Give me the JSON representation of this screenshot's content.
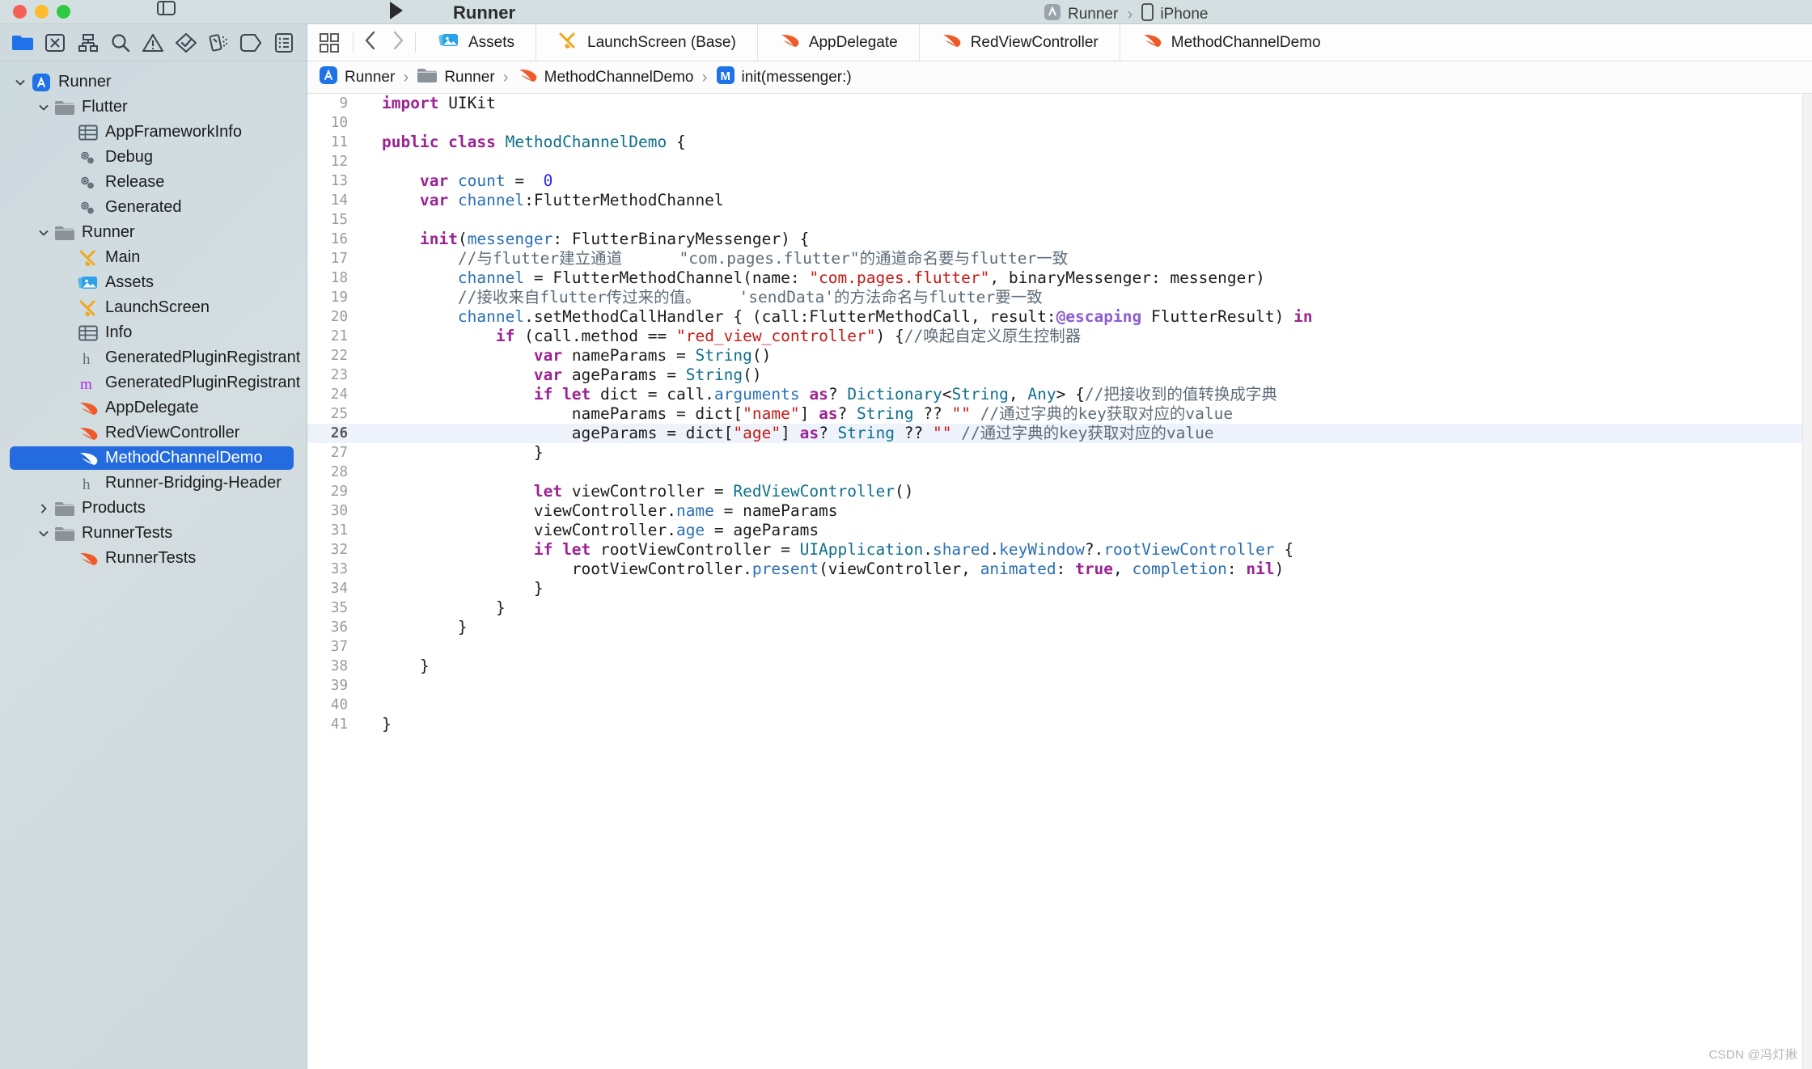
{
  "window": {
    "title": "Runner",
    "right_breadcrumb_project": "Runner",
    "right_breadcrumb_device": "iPhone"
  },
  "navigator_toolbar": {
    "items": [
      {
        "name": "project-navigator-icon",
        "label": "Project"
      },
      {
        "name": "source-control-navigator-icon",
        "label": "Source Control"
      },
      {
        "name": "symbol-navigator-icon",
        "label": "Symbols"
      },
      {
        "name": "find-navigator-icon",
        "label": "Find"
      },
      {
        "name": "issue-navigator-icon",
        "label": "Issues"
      },
      {
        "name": "test-navigator-icon",
        "label": "Tests"
      },
      {
        "name": "debug-navigator-icon",
        "label": "Debug"
      },
      {
        "name": "breakpoint-navigator-icon",
        "label": "Breakpoints"
      },
      {
        "name": "report-navigator-icon",
        "label": "Reports"
      }
    ]
  },
  "navigator": {
    "rows": [
      {
        "label": "Runner",
        "icon": "app-icon",
        "indent": 0,
        "disclosure": "open",
        "selected": false
      },
      {
        "label": "Flutter",
        "icon": "folder-icon",
        "indent": 1,
        "disclosure": "open",
        "selected": false
      },
      {
        "label": "AppFrameworkInfo",
        "icon": "plist-icon",
        "indent": 2,
        "disclosure": "none",
        "selected": false
      },
      {
        "label": "Debug",
        "icon": "config-icon",
        "indent": 2,
        "disclosure": "none",
        "selected": false
      },
      {
        "label": "Release",
        "icon": "config-icon",
        "indent": 2,
        "disclosure": "none",
        "selected": false
      },
      {
        "label": "Generated",
        "icon": "config-icon",
        "indent": 2,
        "disclosure": "none",
        "selected": false
      },
      {
        "label": "Runner",
        "icon": "folder-icon",
        "indent": 1,
        "disclosure": "open",
        "selected": false
      },
      {
        "label": "Main",
        "icon": "storyboard-icon",
        "indent": 2,
        "disclosure": "none",
        "selected": false
      },
      {
        "label": "Assets",
        "icon": "assets-icon",
        "indent": 2,
        "disclosure": "none",
        "selected": false
      },
      {
        "label": "LaunchScreen",
        "icon": "storyboard-icon",
        "indent": 2,
        "disclosure": "none",
        "selected": false
      },
      {
        "label": "Info",
        "icon": "plist-icon",
        "indent": 2,
        "disclosure": "none",
        "selected": false
      },
      {
        "label": "GeneratedPluginRegistrant",
        "icon": "header-icon",
        "indent": 2,
        "disclosure": "none",
        "selected": false
      },
      {
        "label": "GeneratedPluginRegistrant",
        "icon": "objc-icon",
        "indent": 2,
        "disclosure": "none",
        "selected": false
      },
      {
        "label": "AppDelegate",
        "icon": "swift-icon",
        "indent": 2,
        "disclosure": "none",
        "selected": false
      },
      {
        "label": "RedViewController",
        "icon": "swift-icon",
        "indent": 2,
        "disclosure": "none",
        "selected": false
      },
      {
        "label": "MethodChannelDemo",
        "icon": "swift-icon",
        "indent": 2,
        "disclosure": "none",
        "selected": true
      },
      {
        "label": "Runner-Bridging-Header",
        "icon": "header-icon",
        "indent": 2,
        "disclosure": "none",
        "selected": false
      },
      {
        "label": "Products",
        "icon": "folder-icon",
        "indent": 1,
        "disclosure": "closed",
        "selected": false
      },
      {
        "label": "RunnerTests",
        "icon": "folder-icon",
        "indent": 1,
        "disclosure": "open",
        "selected": false
      },
      {
        "label": "RunnerTests",
        "icon": "swift-icon",
        "indent": 2,
        "disclosure": "none",
        "selected": false
      }
    ]
  },
  "tabbar": {
    "tabs": [
      {
        "label": "Assets",
        "icon": "assets-icon"
      },
      {
        "label": "LaunchScreen (Base)",
        "icon": "storyboard-icon"
      },
      {
        "label": "AppDelegate",
        "icon": "swift-icon"
      },
      {
        "label": "RedViewController",
        "icon": "swift-icon"
      },
      {
        "label": "MethodChannelDemo",
        "icon": "swift-icon"
      }
    ]
  },
  "jumpbar": {
    "crumbs": [
      {
        "label": "Runner",
        "icon": "app-icon"
      },
      {
        "label": "Runner",
        "icon": "folder-icon"
      },
      {
        "label": "MethodChannelDemo",
        "icon": "swift-icon"
      },
      {
        "label": "init(messenger:)",
        "icon": "method-icon"
      }
    ]
  },
  "editor": {
    "highlighted_line": 26,
    "lines": [
      {
        "n": 9,
        "tokens": [
          {
            "t": "import ",
            "c": "k"
          },
          {
            "t": "UIKit",
            "c": "tb"
          }
        ]
      },
      {
        "n": 10,
        "tokens": []
      },
      {
        "n": 11,
        "tokens": [
          {
            "t": "public class ",
            "c": "k"
          },
          {
            "t": "MethodChannelDemo",
            "c": "ty"
          },
          {
            "t": " {",
            "c": "tb"
          }
        ]
      },
      {
        "n": 12,
        "tokens": []
      },
      {
        "n": 13,
        "tokens": [
          {
            "t": "    ",
            "c": "tb"
          },
          {
            "t": "var ",
            "c": "k"
          },
          {
            "t": "count",
            "c": "id"
          },
          {
            "t": " =  ",
            "c": "tb"
          },
          {
            "t": "0",
            "c": "num"
          }
        ]
      },
      {
        "n": 14,
        "tokens": [
          {
            "t": "    ",
            "c": "tb"
          },
          {
            "t": "var ",
            "c": "k"
          },
          {
            "t": "channel",
            "c": "id"
          },
          {
            "t": ":FlutterMethodChannel",
            "c": "tb"
          }
        ]
      },
      {
        "n": 15,
        "tokens": []
      },
      {
        "n": 16,
        "tokens": [
          {
            "t": "    ",
            "c": "tb"
          },
          {
            "t": "init",
            "c": "k"
          },
          {
            "t": "(",
            "c": "tb"
          },
          {
            "t": "messenger",
            "c": "id"
          },
          {
            "t": ": FlutterBinaryMessenger) {",
            "c": "tb"
          }
        ]
      },
      {
        "n": 17,
        "tokens": [
          {
            "t": "        ",
            "c": "tb"
          },
          {
            "t": "//与flutter建立通道      ",
            "c": "cm"
          },
          {
            "t": "\"com.pages.flutter\"的通道命名要与flutter一致",
            "c": "cm"
          }
        ]
      },
      {
        "n": 18,
        "tokens": [
          {
            "t": "        ",
            "c": "tb"
          },
          {
            "t": "channel",
            "c": "id"
          },
          {
            "t": " = FlutterMethodChannel(name: ",
            "c": "tb"
          },
          {
            "t": "\"com.pages.flutter\"",
            "c": "st"
          },
          {
            "t": ", binaryMessenger: messenger)",
            "c": "tb"
          }
        ]
      },
      {
        "n": 19,
        "tokens": [
          {
            "t": "        ",
            "c": "tb"
          },
          {
            "t": "//接收来自flutter传过来的值。    'sendData'的方法命名与flutter要一致",
            "c": "cm"
          }
        ]
      },
      {
        "n": 20,
        "tokens": [
          {
            "t": "        ",
            "c": "tb"
          },
          {
            "t": "channel",
            "c": "id"
          },
          {
            "t": ".setMethodCallHandler { (call:FlutterMethodCall, result:",
            "c": "tb"
          },
          {
            "t": "@escaping",
            "c": "at"
          },
          {
            "t": " FlutterResult) ",
            "c": "tb"
          },
          {
            "t": "in",
            "c": "k"
          }
        ]
      },
      {
        "n": 21,
        "tokens": [
          {
            "t": "            ",
            "c": "tb"
          },
          {
            "t": "if",
            "c": "k"
          },
          {
            "t": " (call.method == ",
            "c": "tb"
          },
          {
            "t": "\"red_view_controller\"",
            "c": "st"
          },
          {
            "t": ") {",
            "c": "tb"
          },
          {
            "t": "//唤起自定义原生控制器",
            "c": "cm"
          }
        ]
      },
      {
        "n": 22,
        "tokens": [
          {
            "t": "                ",
            "c": "tb"
          },
          {
            "t": "var ",
            "c": "k"
          },
          {
            "t": "nameParams",
            "c": "tb"
          },
          {
            "t": " = ",
            "c": "tb"
          },
          {
            "t": "String",
            "c": "ty"
          },
          {
            "t": "()",
            "c": "tb"
          }
        ]
      },
      {
        "n": 23,
        "tokens": [
          {
            "t": "                ",
            "c": "tb"
          },
          {
            "t": "var ",
            "c": "k"
          },
          {
            "t": "ageParams",
            "c": "tb"
          },
          {
            "t": " = ",
            "c": "tb"
          },
          {
            "t": "String",
            "c": "ty"
          },
          {
            "t": "()",
            "c": "tb"
          }
        ]
      },
      {
        "n": 24,
        "tokens": [
          {
            "t": "                ",
            "c": "tb"
          },
          {
            "t": "if let ",
            "c": "k"
          },
          {
            "t": "dict = call.",
            "c": "tb"
          },
          {
            "t": "arguments",
            "c": "id"
          },
          {
            "t": " ",
            "c": "tb"
          },
          {
            "t": "as",
            "c": "k"
          },
          {
            "t": "? ",
            "c": "tb"
          },
          {
            "t": "Dictionary",
            "c": "ty"
          },
          {
            "t": "<",
            "c": "tb"
          },
          {
            "t": "String",
            "c": "ty"
          },
          {
            "t": ", ",
            "c": "tb"
          },
          {
            "t": "Any",
            "c": "ty"
          },
          {
            "t": "> {",
            "c": "tb"
          },
          {
            "t": "//把接收到的值转换成字典",
            "c": "cm"
          }
        ]
      },
      {
        "n": 25,
        "tokens": [
          {
            "t": "                    nameParams = dict[",
            "c": "tb"
          },
          {
            "t": "\"name\"",
            "c": "st"
          },
          {
            "t": "] ",
            "c": "tb"
          },
          {
            "t": "as",
            "c": "k"
          },
          {
            "t": "? ",
            "c": "tb"
          },
          {
            "t": "String",
            "c": "ty"
          },
          {
            "t": " ?? ",
            "c": "tb"
          },
          {
            "t": "\"\"",
            "c": "st"
          },
          {
            "t": " ",
            "c": "tb"
          },
          {
            "t": "//通过字典的key获取对应的value",
            "c": "cm"
          }
        ]
      },
      {
        "n": 26,
        "tokens": [
          {
            "t": "                    ageParams = dict[",
            "c": "tb"
          },
          {
            "t": "\"age\"",
            "c": "st"
          },
          {
            "t": "] ",
            "c": "tb"
          },
          {
            "t": "as",
            "c": "k"
          },
          {
            "t": "? ",
            "c": "tb"
          },
          {
            "t": "String",
            "c": "ty"
          },
          {
            "t": " ?? ",
            "c": "tb"
          },
          {
            "t": "\"\"",
            "c": "st"
          },
          {
            "t": " ",
            "c": "tb"
          },
          {
            "t": "//通过字典的key获取对应的value",
            "c": "cm"
          }
        ]
      },
      {
        "n": 27,
        "tokens": [
          {
            "t": "                }",
            "c": "tb"
          }
        ]
      },
      {
        "n": 28,
        "tokens": []
      },
      {
        "n": 29,
        "tokens": [
          {
            "t": "                ",
            "c": "tb"
          },
          {
            "t": "let ",
            "c": "k"
          },
          {
            "t": "viewController = ",
            "c": "tb"
          },
          {
            "t": "RedViewController",
            "c": "ty"
          },
          {
            "t": "()",
            "c": "tb"
          }
        ]
      },
      {
        "n": 30,
        "tokens": [
          {
            "t": "                viewController.",
            "c": "tb"
          },
          {
            "t": "name",
            "c": "id"
          },
          {
            "t": " = nameParams",
            "c": "tb"
          }
        ]
      },
      {
        "n": 31,
        "tokens": [
          {
            "t": "                viewController.",
            "c": "tb"
          },
          {
            "t": "age",
            "c": "id"
          },
          {
            "t": " = ageParams",
            "c": "tb"
          }
        ]
      },
      {
        "n": 32,
        "tokens": [
          {
            "t": "                ",
            "c": "tb"
          },
          {
            "t": "if let ",
            "c": "k"
          },
          {
            "t": "rootViewController = ",
            "c": "tb"
          },
          {
            "t": "UIApplication",
            "c": "ty"
          },
          {
            "t": ".",
            "c": "tb"
          },
          {
            "t": "shared",
            "c": "id"
          },
          {
            "t": ".",
            "c": "tb"
          },
          {
            "t": "keyWindow",
            "c": "id"
          },
          {
            "t": "?.",
            "c": "tb"
          },
          {
            "t": "rootViewController",
            "c": "id"
          },
          {
            "t": " {",
            "c": "tb"
          }
        ]
      },
      {
        "n": 33,
        "tokens": [
          {
            "t": "                    rootViewController.",
            "c": "tb"
          },
          {
            "t": "present",
            "c": "id"
          },
          {
            "t": "(viewController, ",
            "c": "tb"
          },
          {
            "t": "animated",
            "c": "id"
          },
          {
            "t": ": ",
            "c": "tb"
          },
          {
            "t": "true",
            "c": "k"
          },
          {
            "t": ", ",
            "c": "tb"
          },
          {
            "t": "completion",
            "c": "id"
          },
          {
            "t": ": ",
            "c": "tb"
          },
          {
            "t": "nil",
            "c": "k"
          },
          {
            "t": ")",
            "c": "tb"
          }
        ]
      },
      {
        "n": 34,
        "tokens": [
          {
            "t": "                }",
            "c": "tb"
          }
        ]
      },
      {
        "n": 35,
        "tokens": [
          {
            "t": "            }",
            "c": "tb"
          }
        ]
      },
      {
        "n": 36,
        "tokens": [
          {
            "t": "        }",
            "c": "tb"
          }
        ]
      },
      {
        "n": 37,
        "tokens": []
      },
      {
        "n": 38,
        "tokens": [
          {
            "t": "    }",
            "c": "tb"
          }
        ]
      },
      {
        "n": 39,
        "tokens": []
      },
      {
        "n": 40,
        "tokens": []
      },
      {
        "n": 41,
        "tokens": [
          {
            "t": "}",
            "c": "tb"
          }
        ]
      }
    ]
  },
  "watermark": {
    "text": "CSDN @冯灯揪"
  },
  "colors": {
    "selection_blue": "#246bdf",
    "keyword": "#9b2393",
    "string": "#c41a16",
    "comment": "#5d6c79",
    "number": "#2727e6",
    "type": "#0f6f8c",
    "identifier": "#2a6fb5",
    "attribute": "#8c5dd1",
    "swift_orange": "#ef5a28",
    "navigator_bg": "#d0dade"
  }
}
